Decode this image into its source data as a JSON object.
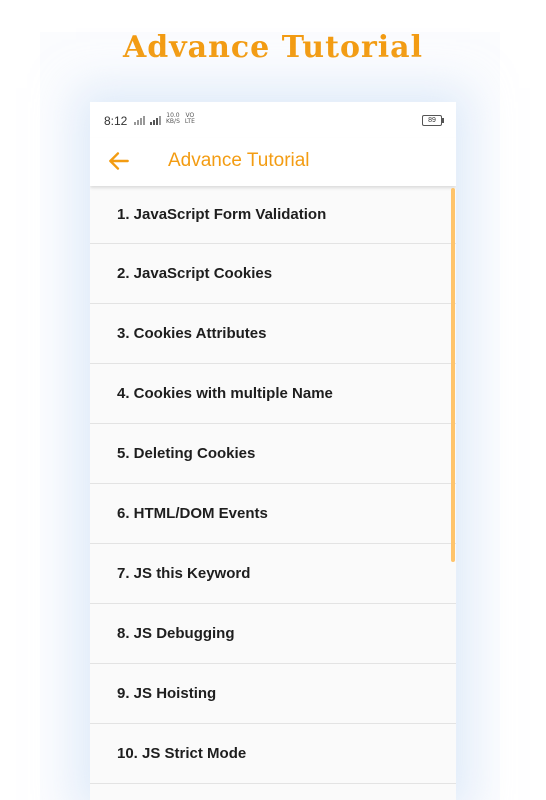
{
  "promo": {
    "title": "Advance Tutorial"
  },
  "status_bar": {
    "time": "8:12",
    "net_speed_value": "10.0",
    "net_speed_unit": "KB/S",
    "vo_label": "VO",
    "lte_label": "LTE",
    "battery": "89"
  },
  "app_bar": {
    "title": "Advance Tutorial",
    "back_icon": "arrow-left-icon"
  },
  "colors": {
    "accent": "#f39c12",
    "scrollbar": "#ffc46b"
  },
  "list": {
    "items": [
      {
        "label": "1. JavaScript Form Validation"
      },
      {
        "label": "2. JavaScript Cookies"
      },
      {
        "label": "3. Cookies Attributes"
      },
      {
        "label": "4. Cookies with multiple Name"
      },
      {
        "label": "5. Deleting Cookies"
      },
      {
        "label": "6. HTML/DOM Events"
      },
      {
        "label": "7. JS this Keyword"
      },
      {
        "label": "8. JS Debugging"
      },
      {
        "label": "9. JS Hoisting"
      },
      {
        "label": "10. JS Strict Mode"
      }
    ]
  }
}
